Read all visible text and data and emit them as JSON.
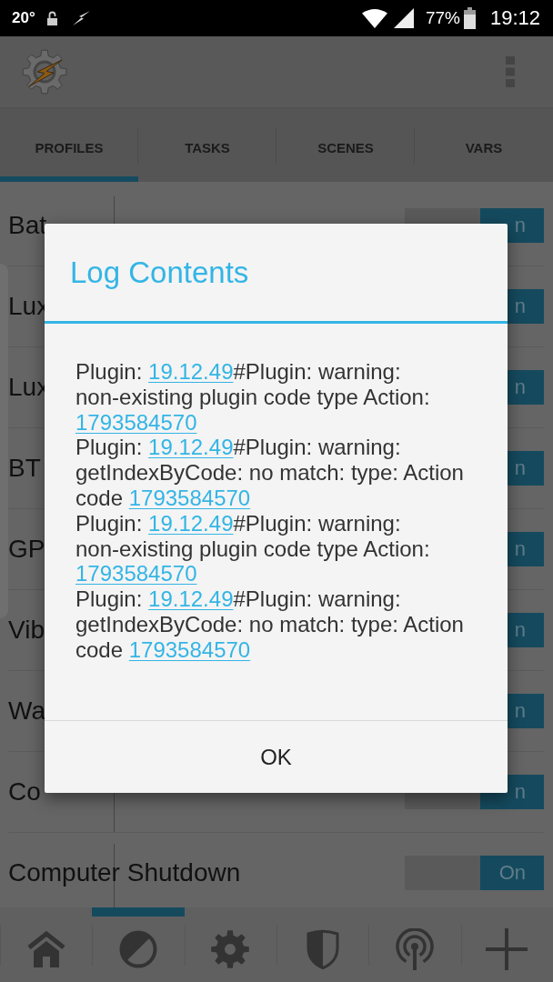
{
  "status_bar": {
    "temperature": "20°",
    "battery": "77%",
    "time": "19:12"
  },
  "tabs": [
    {
      "label": "PROFILES",
      "selected": true
    },
    {
      "label": "TASKS",
      "selected": false
    },
    {
      "label": "SCENES",
      "selected": false
    },
    {
      "label": "VARS",
      "selected": false
    }
  ],
  "profiles": [
    {
      "name": "Bat",
      "toggle": {
        "label": "n",
        "on": true
      }
    },
    {
      "name": "Lux",
      "toggle": {
        "label": "n",
        "on": true
      }
    },
    {
      "name": "Lux",
      "toggle": {
        "label": "n",
        "on": true
      }
    },
    {
      "name": "BT",
      "toggle": {
        "label": "n",
        "on": true
      }
    },
    {
      "name": "GP",
      "toggle": {
        "label": "n",
        "on": true
      }
    },
    {
      "name": "Vib",
      "toggle": {
        "label": "n",
        "on": true
      }
    },
    {
      "name": "Wa",
      "toggle": {
        "label": "n",
        "on": true
      }
    },
    {
      "name": "Co",
      "toggle": {
        "label": "n",
        "on": true
      }
    },
    {
      "name": "Computer Shutdown",
      "toggle": {
        "label": "On",
        "on": true
      }
    }
  ],
  "bottom_nav": [
    {
      "selected": false
    },
    {
      "selected": true
    },
    {
      "selected": false
    },
    {
      "selected": false
    },
    {
      "selected": false
    },
    {
      "selected": false
    }
  ],
  "dialog": {
    "title": "Log Contents",
    "entries": [
      {
        "prefix": "Plugin: ",
        "version": "19.12.49",
        "message": "#Plugin: warning: non-existing plugin code type Action: ",
        "code": "1793584570"
      },
      {
        "prefix": "Plugin: ",
        "version": "19.12.49",
        "message": "#Plugin: warning: getIndexByCode: no match: type: Action code ",
        "code": "1793584570"
      },
      {
        "prefix": "Plugin: ",
        "version": "19.12.49",
        "message": "#Plugin: warning: non-existing plugin code type Action: ",
        "code": "1793584570"
      },
      {
        "prefix": "Plugin: ",
        "version": "19.12.49",
        "message": "#Plugin: warning: getIndexByCode: no match: type: Action code ",
        "code": "1793584570"
      }
    ],
    "button": "OK"
  }
}
